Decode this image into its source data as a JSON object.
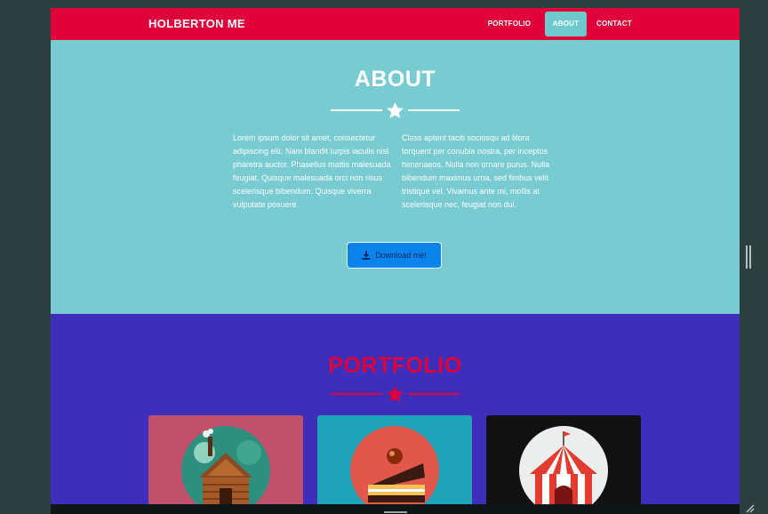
{
  "navbar": {
    "brand": "HOLBERTON ME",
    "items": [
      {
        "label": "PORTFOLIO",
        "active": false
      },
      {
        "label": "ABOUT",
        "active": true
      },
      {
        "label": "CONTACT",
        "active": false
      }
    ]
  },
  "about": {
    "title": "ABOUT",
    "divider_icon": "star-icon",
    "column_left": "Lorem ipsum dolor sit amet, consectetur adipiscing elit. Nam blandit turpis iaculis nisl pharetra auctor. Phasellus mattis malesuada feugiat. Quisque malesuada orci non risus scelerisque bibendum. Quisque viverra vulputate posuere.",
    "column_right": "Class aptent taciti sociosqu ad litora torquent per conubia nostra, per inceptos himenaeos. Nulla non ornare purus. Nulla bibendum maximus urna, sed finibus velit tristique vel. Vivamus ante mi, mollis at scelerisque nec, feugiat non dui.",
    "download_label": "Download me!",
    "download_icon": "download-icon"
  },
  "portfolio": {
    "title": "PORTFOLIO",
    "divider_icon": "star-icon",
    "cards": [
      {
        "icon": "log-cabin-icon",
        "background": "#c0506b"
      },
      {
        "icon": "cake-slice-icon",
        "background": "#1ea3b8"
      },
      {
        "icon": "circus-tent-icon",
        "background": "#111111"
      }
    ]
  },
  "colors": {
    "nav_red": "#e0003a",
    "about_teal": "#78cbd0",
    "portfolio_purple": "#3d2fbb",
    "button_blue": "#0a84ea"
  }
}
